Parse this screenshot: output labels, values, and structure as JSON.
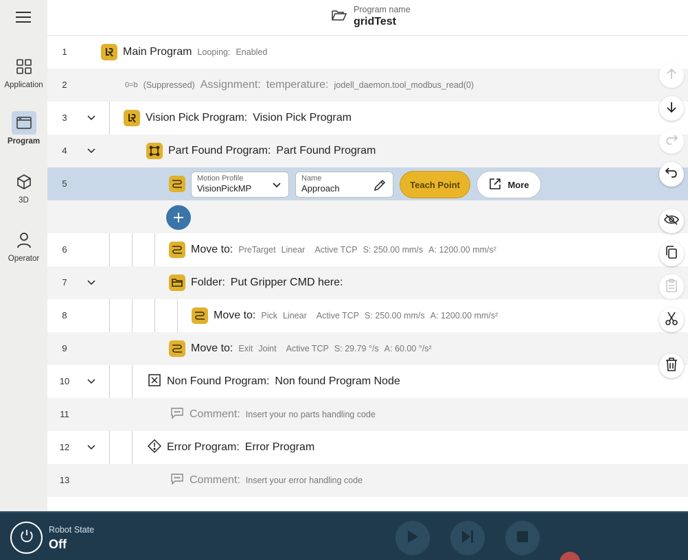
{
  "header": {
    "program_name_label": "Program name",
    "program_name": "gridTest"
  },
  "sidebar": {
    "items": [
      {
        "label": "Application",
        "icon": "grid-icon"
      },
      {
        "label": "Program",
        "icon": "program-icon"
      },
      {
        "label": "3D",
        "icon": "cube-icon"
      },
      {
        "label": "Operator",
        "icon": "person-icon"
      }
    ]
  },
  "rows": {
    "r1": {
      "num": "1",
      "title": "Main Program",
      "meta1": "Looping:",
      "meta2": "Enabled"
    },
    "r2": {
      "num": "2",
      "icon_text": "0=b",
      "suppressed": "(Suppressed)",
      "title": "Assignment:",
      "var": "temperature:",
      "value": "jodell_daemon.tool_modbus_read(0)"
    },
    "r3": {
      "num": "3",
      "title": "Vision Pick Program:",
      "value": "Vision Pick Program"
    },
    "r4": {
      "num": "4",
      "title": "Part Found Program:",
      "value": "Part Found Program"
    },
    "r5": {
      "num": "5",
      "motion_profile_label": "Motion Profile",
      "motion_profile_value": "VisionPickMP",
      "name_label": "Name",
      "name_value": "Approach",
      "teach_point": "Teach Point",
      "more": "More"
    },
    "r6": {
      "num": "6",
      "title": "Move to:",
      "target": "PreTarget",
      "type": "Linear",
      "tcp": "Active TCP",
      "speed": "S: 250.00 mm/s",
      "accel": "A: 1200.00 mm/s²"
    },
    "r7": {
      "num": "7",
      "title": "Folder:",
      "value": "Put Gripper CMD here:"
    },
    "r8": {
      "num": "8",
      "title": "Move to:",
      "target": "Pick",
      "type": "Linear",
      "tcp": "Active TCP",
      "speed": "S: 250.00 mm/s",
      "accel": "A: 1200.00 mm/s²"
    },
    "r9": {
      "num": "9",
      "title": "Move to:",
      "target": "Exit",
      "type": "Joint",
      "tcp": "Active TCP",
      "speed": "S: 29.79 °/s",
      "accel": "A: 60.00 °/s²"
    },
    "r10": {
      "num": "10",
      "title": "Non Found Program:",
      "value": "Non found Program Node"
    },
    "r11": {
      "num": "11",
      "title": "Comment:",
      "value": "Insert your no parts handling code"
    },
    "r12": {
      "num": "12",
      "title": "Error Program:",
      "value": "Error Program"
    },
    "r13": {
      "num": "13",
      "title": "Comment:",
      "value": "Insert your error handling code"
    }
  },
  "footer": {
    "robot_state_label": "Robot State",
    "robot_state_value": "Off"
  },
  "colors": {
    "accent_yellow": "#e8b529",
    "selected_row": "#c9d8e8",
    "footer_bg": "#1f3a4d",
    "add_button": "#3a74a8"
  }
}
